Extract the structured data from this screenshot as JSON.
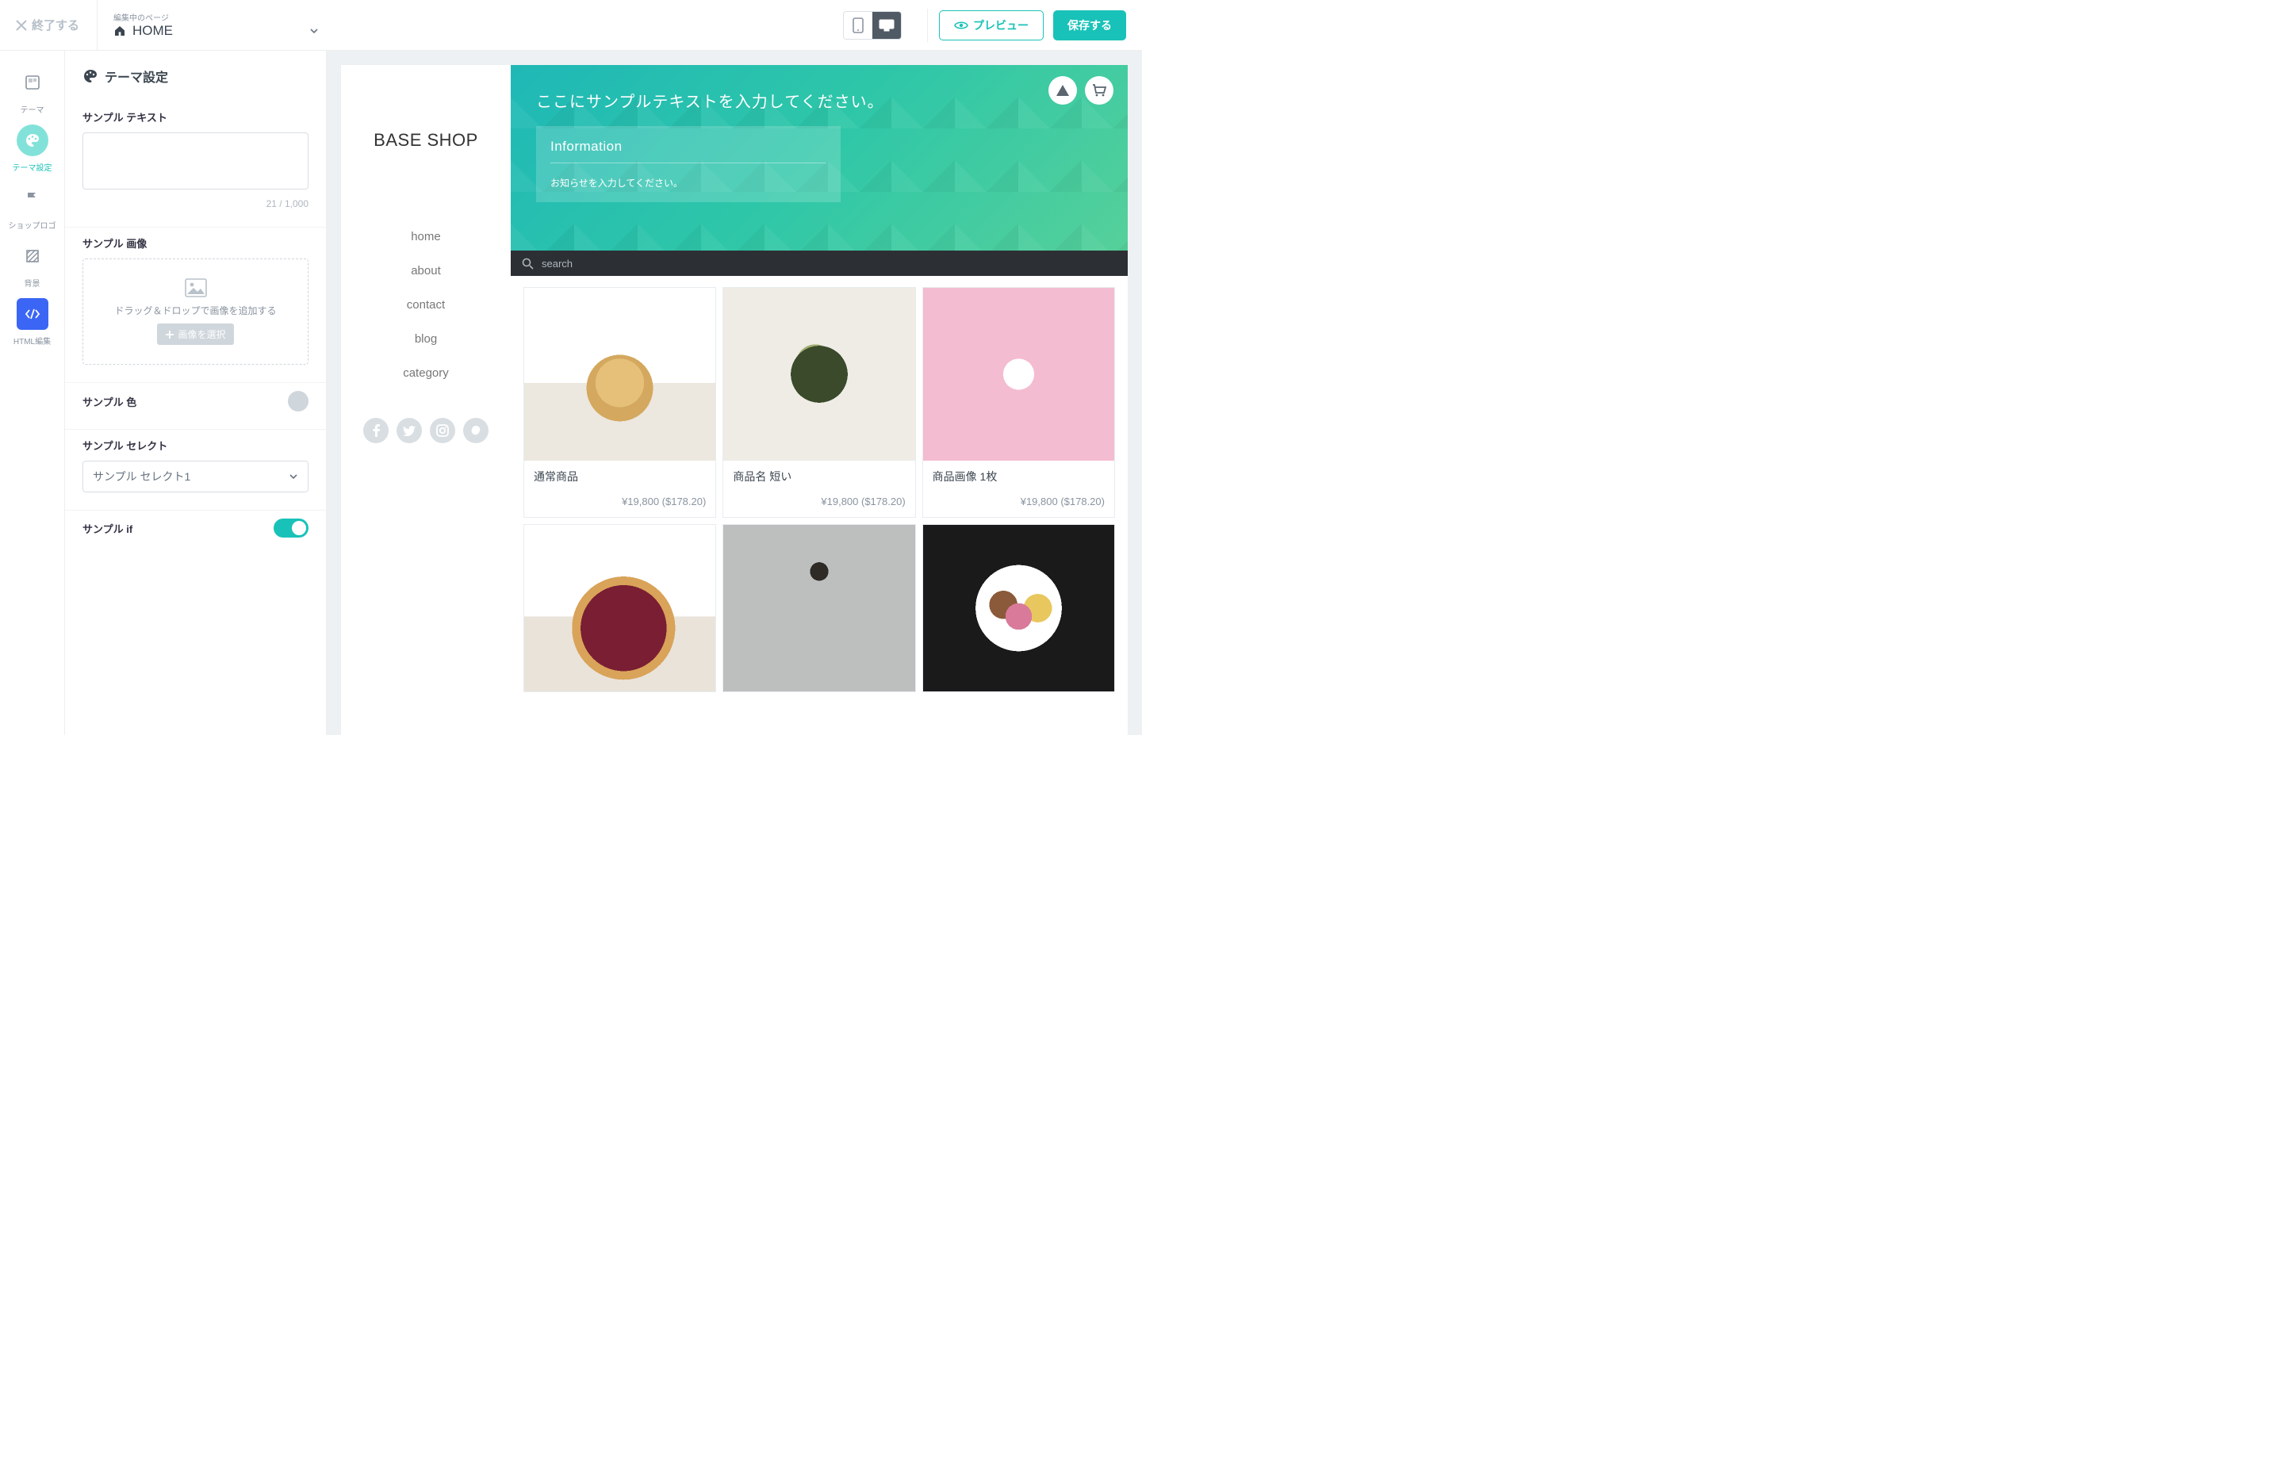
{
  "topbar": {
    "exit": "終了する",
    "editing_label": "編集中のページ",
    "page_name": "HOME",
    "preview": "プレビュー",
    "save": "保存する"
  },
  "iconbar": {
    "items": [
      {
        "label": "テーマ"
      },
      {
        "label": "テーマ設定"
      },
      {
        "label": "ショップロゴ"
      },
      {
        "label": "背景"
      },
      {
        "label": "HTML編集"
      }
    ]
  },
  "panel": {
    "title": "テーマ設定",
    "text_label": "サンプル テキスト",
    "text_counter": "21 / 1,000",
    "image_label": "サンプル 画像",
    "drop_hint": "ドラッグ＆ドロップで画像を追加する",
    "pick_image": "画像を選択",
    "color_label": "サンプル 色",
    "select_label": "サンプル セレクト",
    "select_value": "サンプル セレクト1",
    "if_label": "サンプル if"
  },
  "site": {
    "brand": "BASE SHOP",
    "nav": [
      "home",
      "about",
      "contact",
      "blog",
      "category"
    ],
    "hero_text": "ここにサンプルテキストを入力してください。",
    "info_title": "Information",
    "info_body": "お知らせを入力してください。",
    "search_placeholder": "search",
    "products": [
      {
        "title": "通常商品",
        "price": "¥19,800 ($178.20)"
      },
      {
        "title": "商品名 短い",
        "price": "¥19,800 ($178.20)"
      },
      {
        "title": "商品画像 1枚",
        "price": "¥19,800 ($178.20)"
      }
    ]
  }
}
